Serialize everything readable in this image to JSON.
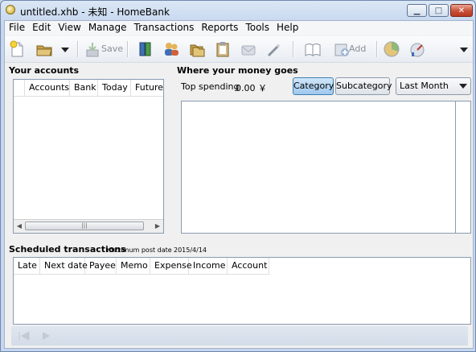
{
  "window": {
    "title": "untitled.xhb - 未知 - HomeBank",
    "minimize": "▁",
    "maximize": "□",
    "close": "✕"
  },
  "menu": [
    "File",
    "Edit",
    "View",
    "Manage",
    "Transactions",
    "Reports",
    "Tools",
    "Help"
  ],
  "toolbar": {
    "save_label": "Save",
    "add_label": "Add",
    "overflow_icon": "chevron-down-icon"
  },
  "accounts": {
    "title": "Your accounts",
    "columns": [
      "Accounts",
      "Bank",
      "Today",
      "Future"
    ],
    "scroll_grip": "|||"
  },
  "spending": {
    "title": "Where your money goes",
    "top_spending_label": "Top spending",
    "top_spending_value": "0.00 ￥",
    "category_button": "Category",
    "subcategory_button": "Subcategory",
    "period_selected": "Last Month"
  },
  "scheduled": {
    "title": "Scheduled transactions",
    "max_post_label": "maximum post date",
    "max_post_value": "2015/4/14",
    "columns": [
      "Late",
      "Next date",
      "Payee",
      "Memo",
      "Expense",
      "Income",
      "Account"
    ]
  },
  "colors": {
    "active_button": "#9fc8ee",
    "window_frame": "#c5d6ee"
  }
}
